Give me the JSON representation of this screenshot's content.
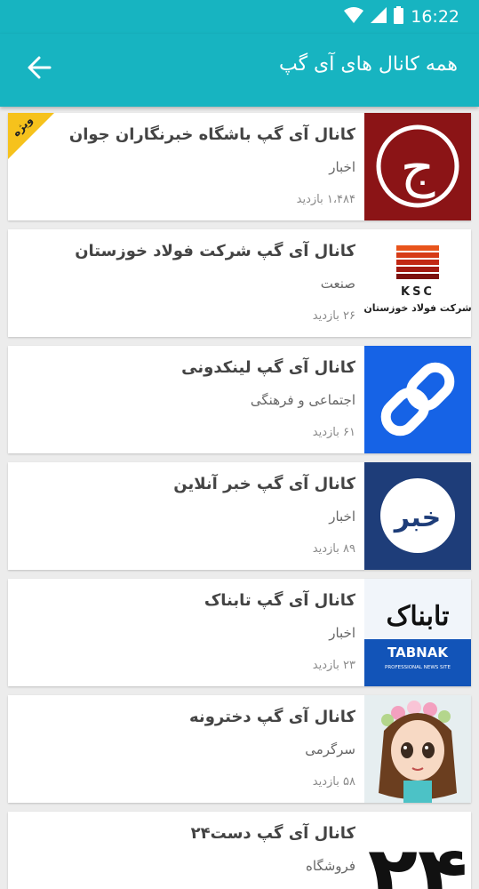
{
  "status": {
    "time": "16:22"
  },
  "toolbar": {
    "title": "همه کانال های آی گپ"
  },
  "channels": [
    {
      "name": "کانال آی گپ باشگاه خبرنگاران جوان",
      "category": "اخبار",
      "views": "۱،۴۸۴ بازدید",
      "badge": "ویژه",
      "logo_text": "ج"
    },
    {
      "name": "کانال آی گپ شرکت فولاد خوزستان",
      "category": "صنعت",
      "views": "۲۶ بازدید",
      "logo_text": "KSC",
      "logo_subtext": "شرکت فولاد خوزستان"
    },
    {
      "name": "کانال آی گپ لینکدونی",
      "category": "اجتماعی و فرهنگی",
      "views": "۶۱ بازدید"
    },
    {
      "name": "کانال آی گپ خبر آنلاین",
      "category": "اخبار",
      "views": "۸۹ بازدید",
      "logo_text": "خبر"
    },
    {
      "name": "کانال آی گپ تابناک",
      "category": "اخبار",
      "views": "۲۳ بازدید",
      "logo_text": "تابناک",
      "logo_subtext": "TABNAK",
      "logo_caption": "PROFESSIONAL NEWS SITE"
    },
    {
      "name": "کانال آی گپ دخترونه",
      "category": "سرگرمی",
      "views": "۵۸ بازدید"
    },
    {
      "name": "کانال آی گپ دست۲۴",
      "category": "فروشگاه",
      "views": "",
      "logo_text": "۲۴"
    }
  ]
}
